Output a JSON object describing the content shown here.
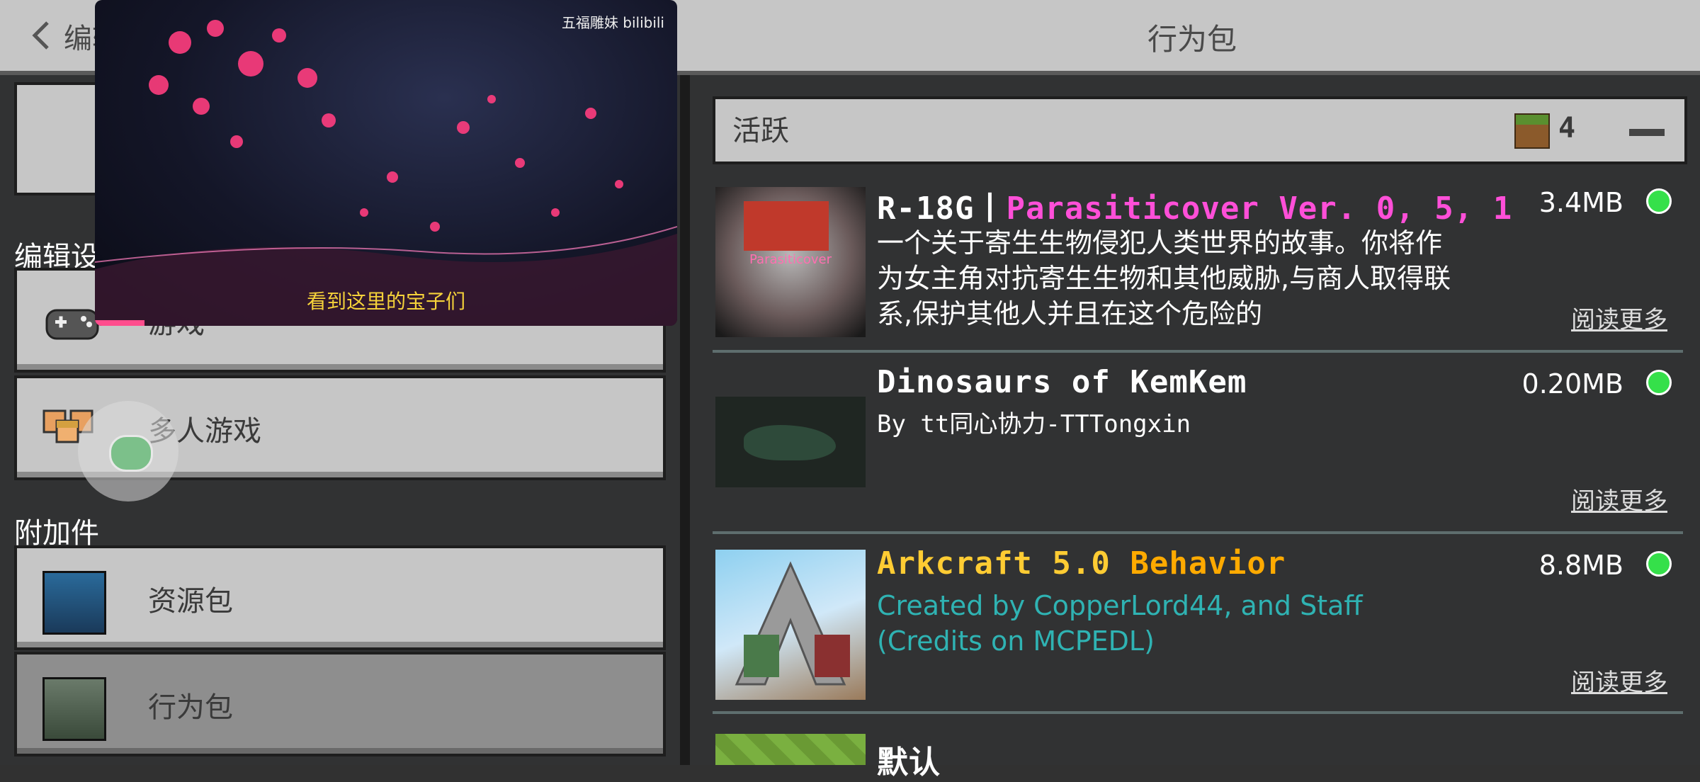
{
  "header": {
    "back_label": "编辑",
    "title": "行为包"
  },
  "left": {
    "section_edit": "编辑设置",
    "game_label": "游戏",
    "multiplayer_label": "多人游戏",
    "section_addons": "附加件",
    "resource_label": "资源包",
    "behavior_label": "行为包"
  },
  "active": {
    "label": "活跃",
    "count": "4"
  },
  "packs": [
    {
      "name_prefix": "R-18G丨",
      "name_main": "Parasiticover Ver. 0, 5, 1",
      "name_main_color": "#ff4fd8",
      "desc": " 一个关于寄生生物侵犯人类世界的故事。你将作为女主角对抗寄生生物和其他威胁,与商人取得联系,保护其他人并且在这个危险的",
      "size": "3.4MB",
      "more": "阅读更多",
      "thumb_text": "Parasiticover"
    },
    {
      "name_prefix": "",
      "name_main": "Dinosaurs of KemKem",
      "name_main_color": "#ffffff",
      "desc": "By tt同心协力-TTTongxin",
      "size": "0.20MB",
      "more": "阅读更多"
    },
    {
      "name_prefix": "Arkcraft 5.0 ",
      "name_main": "Behavior",
      "name_main_color": "#ffaa00",
      "desc": "Created by CopperLord44, and Staff  (Credits on MCPEDL)",
      "desc_color": "#2fb3b3",
      "size": "8.8MB",
      "more": "阅读更多"
    },
    {
      "name_prefix": "",
      "name_main": "默认",
      "name_main_color": "#ffffff"
    }
  ],
  "video": {
    "watermark": "五福雕妹 bilibili",
    "subtitle": "看到这里的宝子们"
  },
  "colors": {
    "button": "#c6c6c6",
    "active_button": "#8e8e8e",
    "panel": "#313233",
    "enabled_dot": "#35e04a"
  },
  "icons": [
    "back-chevron-icon",
    "controller-icon",
    "players-icon",
    "grass-block-icon",
    "minus-icon",
    "chat-bubble-icon"
  ]
}
